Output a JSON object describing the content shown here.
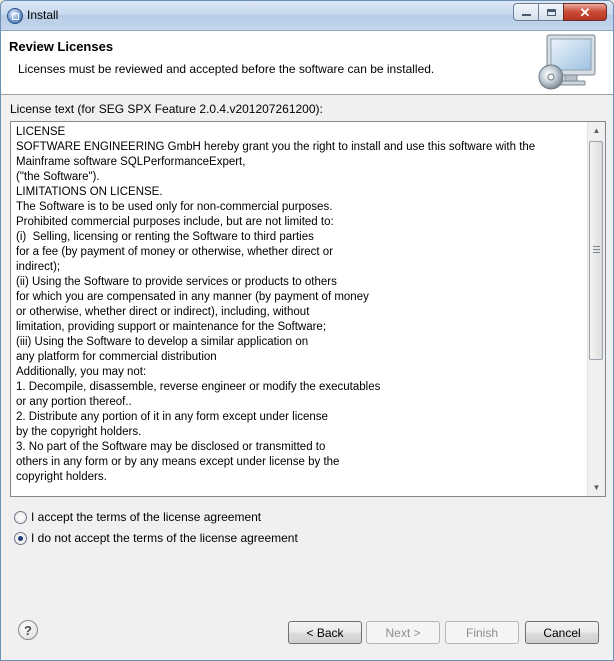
{
  "window": {
    "title": "Install",
    "controls": {
      "minimize_icon": "minimize-icon",
      "maximize_icon": "maximize-icon",
      "close_icon": "close-icon"
    }
  },
  "header": {
    "title": "Review Licenses",
    "description": "Licenses must be reviewed and accepted before the software can be installed.",
    "icon": "monitor-cd-icon"
  },
  "license": {
    "label": "License text (for SEG SPX Feature 2.0.4.v201207261200):",
    "text_lines": [
      "LICENSE",
      "SOFTWARE ENGINEERING GmbH hereby grant you the right to install and use this software with the",
      "Mainframe software SQLPerformanceExpert,",
      "(\"the Software\").",
      "LIMITATIONS ON LICENSE.",
      "The Software is to be used only for non-commercial purposes.",
      "Prohibited commercial purposes include, but are not limited to:",
      "(i)  Selling, licensing or renting the Software to third parties",
      "for a fee (by payment of money or otherwise, whether direct or",
      "indirect);",
      "(ii) Using the Software to provide services or products to others",
      "for which you are compensated in any manner (by payment of money",
      "or otherwise, whether direct or indirect), including, without",
      "limitation, providing support or maintenance for the Software;",
      "(iii) Using the Software to develop a similar application on",
      "any platform for commercial distribution",
      "Additionally, you may not:",
      "1. Decompile, disassemble, reverse engineer or modify the executables",
      "or any portion thereof..",
      "2. Distribute any portion of it in any form except under license",
      "by the copyright holders.",
      "3. No part of the Software may be disclosed or transmitted to",
      "others in any form or by any means except under license by the",
      "copyright holders."
    ]
  },
  "options": {
    "accept_label": "I accept the terms of the license agreement",
    "decline_label": "I do not accept the terms of the license agreement",
    "selected": "decline"
  },
  "footer": {
    "help_icon": "help-icon",
    "back_label": "< Back",
    "next_label": "Next >",
    "finish_label": "Finish",
    "cancel_label": "Cancel"
  },
  "colors": {
    "header_bg": "#ffffff",
    "dialog_bg": "#f0f0f0",
    "close_button": "#c94a35"
  }
}
